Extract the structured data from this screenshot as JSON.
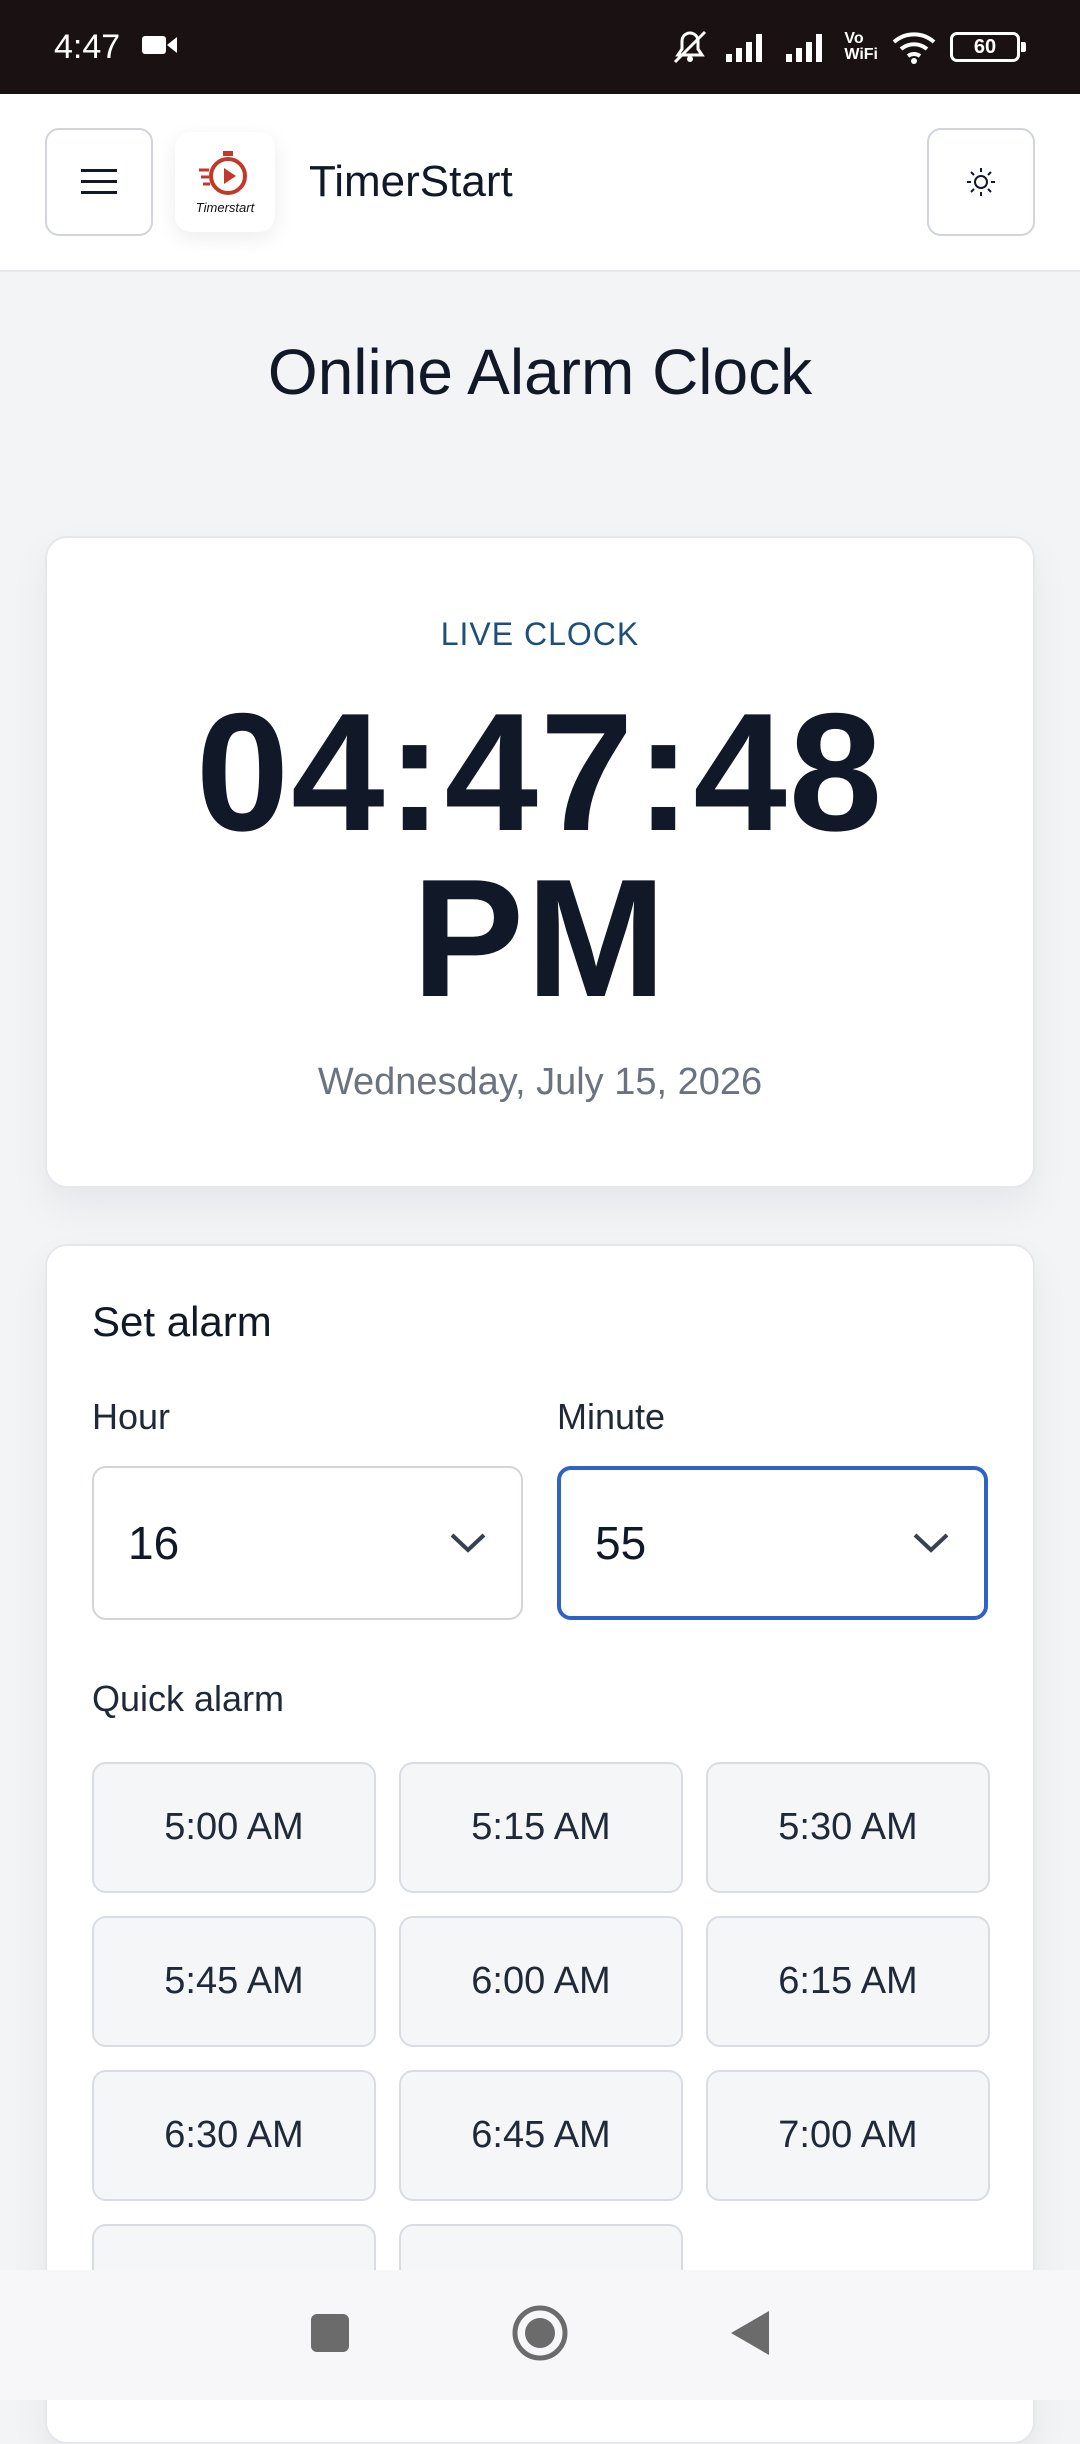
{
  "status_bar": {
    "time": "4:47",
    "vowifi_top": "Vo",
    "vowifi_bottom": "WiFi",
    "battery": "60",
    "icons": [
      "video-camera-icon",
      "mute-icon",
      "signal-icon",
      "signal-icon",
      "vowifi-icon",
      "wifi-icon",
      "battery-icon"
    ]
  },
  "header": {
    "menu_icon": "hamburger-menu-icon",
    "logo_text": "Timerstart",
    "brand": "TimerStart",
    "theme_icon": "sun-icon"
  },
  "page": {
    "title": "Online Alarm Clock"
  },
  "clock": {
    "label": "LIVE CLOCK",
    "time_line1": "04:47:48",
    "time_line2": "PM",
    "date": "Wednesday, July 15, 2026"
  },
  "alarm": {
    "title": "Set alarm",
    "hour_label": "Hour",
    "hour_value": "16",
    "minute_label": "Minute",
    "minute_value": "55",
    "quick_title": "Quick alarm",
    "quick_options": [
      "5:00 AM",
      "5:15 AM",
      "5:30 AM",
      "5:45 AM",
      "6:00 AM",
      "6:15 AM",
      "6:30 AM",
      "6:45 AM",
      "7:00 AM",
      "",
      ""
    ]
  },
  "colors": {
    "accent_blue": "#2f62c5",
    "label_blue": "#1e4f7a",
    "brand_red": "#c0392b"
  },
  "nav_bar": {
    "icons": [
      "recent-apps-icon",
      "home-icon",
      "back-icon"
    ]
  }
}
